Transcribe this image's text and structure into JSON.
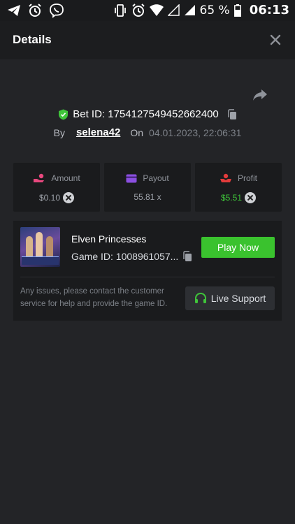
{
  "status_bar": {
    "battery": "65 %",
    "time": "06:13",
    "left_icons": [
      "telegram-icon",
      "alarm-icon",
      "viber-icon"
    ],
    "right_icons": [
      "vibrate-icon",
      "alarm-icon",
      "wifi-icon",
      "signal-empty-icon",
      "signal-icon",
      "battery-icon"
    ]
  },
  "header": {
    "title": "Details",
    "close_icon": "close-icon"
  },
  "bet": {
    "id_label": "Bet ID: 1754127549452662400",
    "by_label": "By",
    "user": "selena42",
    "on_label": "On",
    "date": "04.01.2023, 22:06:31"
  },
  "stats": [
    {
      "label": "Amount",
      "value": "$0.10",
      "icon": "hand-coins-icon"
    },
    {
      "label": "Payout",
      "value": "55.81 x",
      "icon": "card-icon"
    },
    {
      "label": "Profit",
      "value": "$5.51",
      "icon": "profit-hand-icon"
    }
  ],
  "game": {
    "title": "Elven Princesses",
    "id_label": "Game ID: 1008961057...",
    "play_label": "Play Now",
    "support_text": "Any issues, please contact the customer service for help and provide the game ID.",
    "support_label": "Live Support"
  },
  "colors": {
    "accent_green": "#3ac22e",
    "amount_icon": "#e8487e",
    "payout_icon": "#8b4fe0",
    "profit_icon": "#e23b3b"
  }
}
